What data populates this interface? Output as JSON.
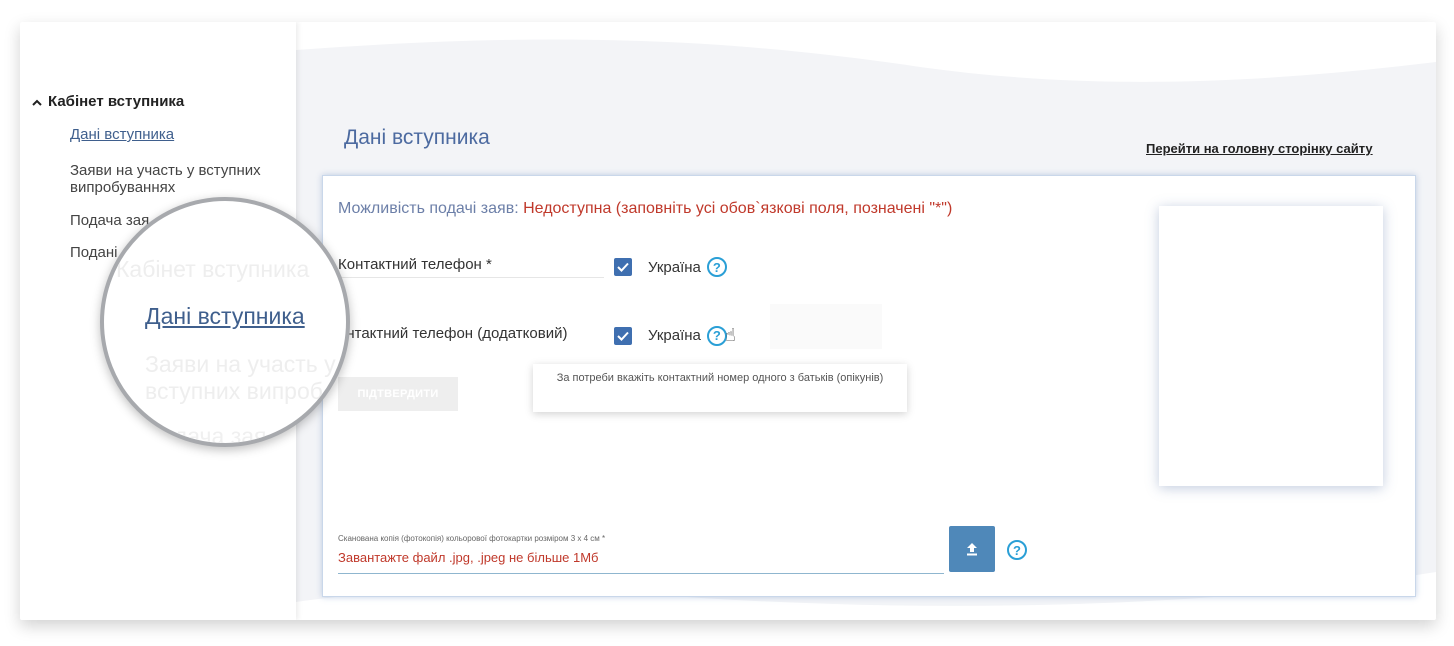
{
  "sidebar": {
    "header": "Кабінет вступника",
    "items": [
      {
        "label": "Дані вступника"
      },
      {
        "label": "Заяви на участь у вступних випробуваннях"
      },
      {
        "label": "Подача зая"
      },
      {
        "label": "Подані"
      }
    ]
  },
  "page": {
    "title": "Дані вступника",
    "home_link": "Перейти на головну сторінку сайту"
  },
  "form": {
    "status_label": "Можливість подачі заяв:",
    "status_value": "Недоступна (заповніть усі обов`язкові поля, позначені \"*\")",
    "phone_label": "Контактний телефон *",
    "phone_country": "Україна",
    "phone2_label": "онтактний телефон (додатковий)",
    "phone2_country": "Україна",
    "confirm_label": "ПІДТВЕРДИТИ",
    "tooltip": "За потреби вкажіть контактний номер одного з батьків (опікунів)",
    "upload_caption": "Сканована копія (фотокопія) кольорової фотокартки розміром 3 х 4 см *",
    "upload_placeholder": "Завантажте файл .jpg, .jpeg не більше 1Мб"
  },
  "magnifier": {
    "line1": "Кабінет вступника",
    "line2": "Дані вступника",
    "line3a": "Заяви на участь у",
    "line3b": "вступних випроб",
    "line4": "Подача зая"
  },
  "colors": {
    "accent": "#3f5f8d",
    "error": "#c0392b",
    "checkbox": "#3f6fb0",
    "help": "#2a9fd6",
    "upload_button": "#4f88b9"
  },
  "icons": {
    "sidebar_toggle": "chevron-up-icon",
    "checkbox": "check-icon",
    "help": "question-circle-icon",
    "cursor": "hand-pointer-icon",
    "upload": "upload-icon"
  }
}
